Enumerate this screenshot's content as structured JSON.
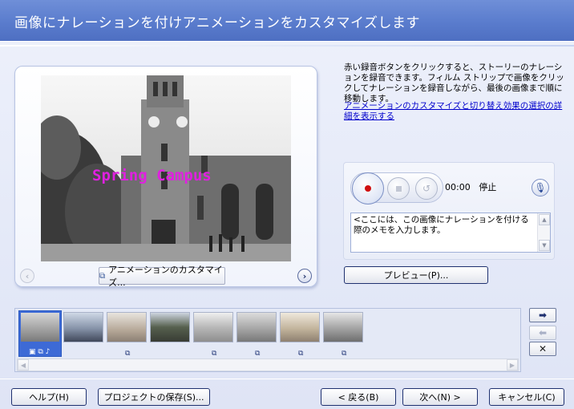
{
  "header": {
    "title": "画像にナレーションを付けアニメーションをカスタマイズします"
  },
  "preview": {
    "caption": "Spring Campus",
    "customize_label": "アニメーションのカスタマイズ..."
  },
  "instructions": {
    "text": "赤い録音ボタンをクリックすると、ストーリーのナレーションを録音できます。フィルム ストリップで画像をクリックしてナレーションを録音しながら、最後の画像まで順に移動します。",
    "link": "アニメーションのカスタマイズと切り替え効果の選択の詳細を表示する"
  },
  "narration": {
    "time": "00:00",
    "status": "停止",
    "memo_placeholder": "<ここには、この画像にナレーションを付ける際のメモを入力します。"
  },
  "preview_button": "プレビュー(P)...",
  "footer": {
    "help": "ヘルプ(H)",
    "save_project": "プロジェクトの保存(S)...",
    "back": "< 戻る(B)",
    "next": "次へ(N) >",
    "cancel": "キャンセル(C)"
  },
  "colors": {
    "header": "#5a7ccd",
    "accent": "#2c5ac0",
    "record": "#d01010",
    "caption": "#e020e0"
  },
  "filmstrip": {
    "thumbnail_count": 8,
    "selected_index": 0
  }
}
